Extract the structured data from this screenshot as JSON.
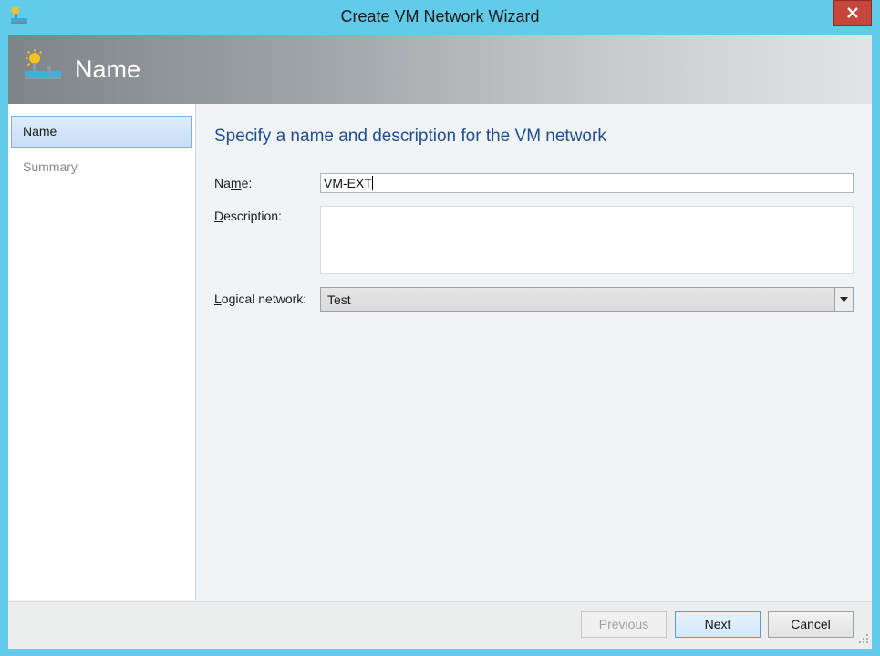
{
  "window": {
    "title": "Create VM Network Wizard",
    "close_label": "✕"
  },
  "banner": {
    "title": "Name"
  },
  "sidebar": {
    "items": [
      {
        "label": "Name",
        "active": true
      },
      {
        "label": "Summary",
        "active": false
      }
    ]
  },
  "main": {
    "heading": "Specify a name and description for the VM network",
    "name_label_pre": "Na",
    "name_label_u": "m",
    "name_label_post": "e:",
    "name_value": "VM-EXT",
    "description_label_u": "D",
    "description_label_post": "escription:",
    "description_value": "",
    "logical_network_label_u": "L",
    "logical_network_label_post": "ogical network:",
    "logical_network_value": "Test"
  },
  "footer": {
    "previous_u": "P",
    "previous_post": "revious",
    "next_u": "N",
    "next_post": "ext",
    "cancel_label": "Cancel"
  },
  "colors": {
    "window_frame": "#62cbe9",
    "close_button": "#c7463b",
    "heading_text": "#1f4e8c",
    "active_nav_border": "#7fb0e4"
  },
  "icons": {
    "app": "network-wizard-icon",
    "banner": "vm-network-icon",
    "close": "close-icon",
    "dropdown": "chevron-down-icon",
    "grip": "resize-grip-icon"
  }
}
